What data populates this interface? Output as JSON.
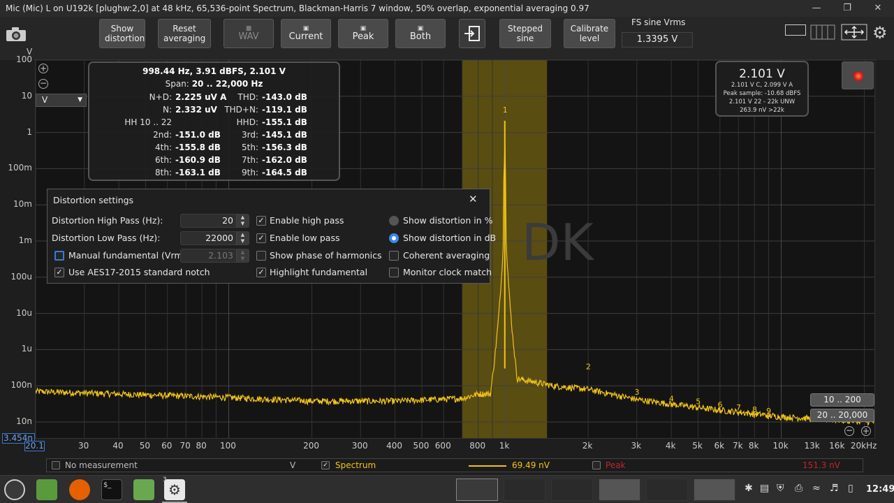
{
  "window": {
    "title": "Mic (Mic) L on U192k [plughw:2,0] at 48 kHz, 65,536-point Spectrum, Blackman-Harris 7 window, 50% overlap, exponential averaging 0.97"
  },
  "toolbar": {
    "show_distortion": "Show distortion",
    "reset_averaging": "Reset averaging",
    "wav": "WAV",
    "current": "Current",
    "peak": "Peak",
    "both": "Both",
    "stepped_sine": "Stepped sine",
    "calibrate_level": "Calibrate level",
    "fs_label": "FS sine Vrms",
    "fs_value": "1.3395 V"
  },
  "plot": {
    "unit_selected": "V",
    "y_ticks": [
      "100",
      "10",
      "1",
      "100m",
      "10m",
      "1m",
      "100u",
      "10u",
      "1u",
      "100n",
      "10n"
    ],
    "y_min_label": "3.454n",
    "x_min_label": "20.1",
    "x_ticks": [
      "30",
      "40",
      "50",
      "60",
      "70",
      "80",
      "100",
      "200",
      "300",
      "400",
      "500",
      "600",
      "800",
      "1k",
      "2k",
      "3k",
      "4k",
      "5k",
      "6k",
      "7k",
      "8k",
      "10k",
      "13k",
      "16k",
      "20kHz"
    ],
    "watermark": "DK",
    "harmonic_labels": [
      "1",
      "2",
      "3",
      "4",
      "5",
      "6",
      "7",
      "8",
      "9"
    ],
    "range_buttons": [
      "10 .. 200",
      "20 .. 20,000"
    ]
  },
  "stats": {
    "header": "998.44 Hz, 3.91 dBFS, 2.101 V",
    "span_label": "Span:",
    "span_value": "20 .. 22,000 Hz",
    "rows": [
      {
        "l_label": "N+D:",
        "l_value": "2.225 uV A",
        "r_label": "THD:",
        "r_value": "-143.0 dB"
      },
      {
        "l_label": "N:",
        "l_value": "2.332 uV",
        "r_label": "THD+N:",
        "r_value": "-119.1 dB"
      },
      {
        "l_label": "HH 10 .. 22",
        "l_value": "",
        "r_label": "HHD:",
        "r_value": "-155.1 dB"
      },
      {
        "l_label": "2nd:",
        "l_value": "-151.0 dB",
        "r_label": "3rd:",
        "r_value": "-145.1 dB"
      },
      {
        "l_label": "4th:",
        "l_value": "-155.8 dB",
        "r_label": "5th:",
        "r_value": "-156.3 dB"
      },
      {
        "l_label": "6th:",
        "l_value": "-160.9 dB",
        "r_label": "7th:",
        "r_value": "-162.0 dB"
      },
      {
        "l_label": "8th:",
        "l_value": "-163.1 dB",
        "r_label": "9th:",
        "r_value": "-164.5 dB"
      }
    ]
  },
  "level": {
    "main": "2.101 V",
    "lines": [
      "2.101 V C, 2.099 V A",
      "Peak sample: -10.68 dBFS",
      "2.101 V 22 - 22k UNW",
      "263.9 nV >22k"
    ]
  },
  "dialog": {
    "title": "Distortion settings",
    "hp_label": "Distortion High Pass (Hz):",
    "hp_value": "20",
    "lp_label": "Distortion Low Pass (Hz):",
    "lp_value": "22000",
    "manual_fund": "Manual fundamental (Vrms)",
    "manual_value": "2.103",
    "aes": "Use AES17-2015 standard notch",
    "enable_hp": "Enable high pass",
    "enable_lp": "Enable low pass",
    "phase": "Show phase of harmonics",
    "highlight": "Highlight fundamental",
    "show_pct": "Show distortion in %",
    "show_db": "Show distortion in dB",
    "coherent": "Coherent averaging",
    "monitor": "Monitor clock match"
  },
  "legend": {
    "no_measurement": "No measurement",
    "unit": "V",
    "spectrum": "Spectrum",
    "spectrum_value": "69.49 nV",
    "peak": "Peak",
    "peak_value": "151.3 nV",
    "spectrum_color": "#f2c418",
    "peak_color": "#c0262a"
  },
  "taskbar": {
    "badge": "3",
    "clock": "12:49"
  },
  "colors": {
    "trace": "#f2c418",
    "highlight_band": "#5a4d12",
    "grid": "#3a3a3a"
  }
}
